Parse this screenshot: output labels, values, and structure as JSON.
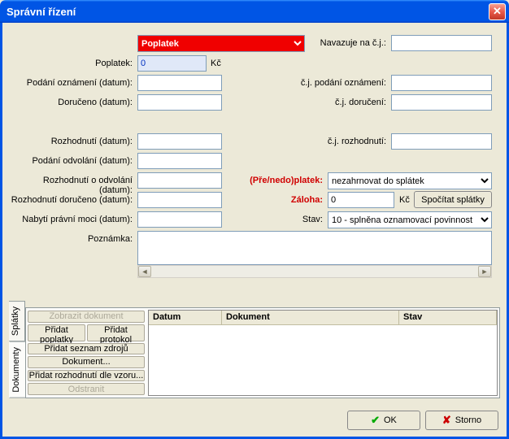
{
  "window": {
    "title": "Správní řízení"
  },
  "topSelect": {
    "value": "Poplatek"
  },
  "labels": {
    "navazuje": "Navazuje na č.j.:",
    "poplatek": "Poplatek:",
    "kc": "Kč",
    "podaniOznameni": "Podání oznámení (datum):",
    "doruceno": "Doručeno (datum):",
    "cjPodani": "č.j. podání oznámení:",
    "cjDoruceni": "č.j. doručení:",
    "rozhodnuti": "Rozhodnutí (datum):",
    "cjRozhodnuti": "č.j. rozhodnutí:",
    "podaniOdvolani": "Podání odvolání (datum):",
    "rozhodnutiOdvolani": "Rozhodnutí o odvolání (datum):",
    "preNedoplatek": "(Pře/nedo)platek:",
    "rozhodnutiDoruceno": "Rozhodnutí doručeno (datum):",
    "zaloha": "Záloha:",
    "nabytiMoci": "Nabytí právní moci (datum):",
    "stav": "Stav:",
    "poznamka": "Poznámka:"
  },
  "values": {
    "poplatek": "0",
    "zaloha": "0",
    "splatSelect": "nezahrnovat do splátek",
    "stavSelect": "10 - splněna oznamovací povinnost"
  },
  "buttons": {
    "spocitatSplatky": "Spočítat splátky",
    "zobrazitDokument": "Zobrazit dokument",
    "pridatPoplatky": "Přidat poplatky",
    "pridatProtokol": "Přidat protokol",
    "pridatSeznamZdroju": "Přidat seznam zdrojů",
    "dokument": "Dokument...",
    "pridatRozhodnuti": "Přidat rozhodnutí dle vzoru...",
    "odstranit": "Odstranit",
    "ok": "OK",
    "storno": "Storno"
  },
  "tabs": {
    "dokumenty": "Dokumenty",
    "splatky": "Splátky"
  },
  "grid": {
    "cols": [
      "Datum",
      "Dokument",
      "Stav"
    ]
  }
}
